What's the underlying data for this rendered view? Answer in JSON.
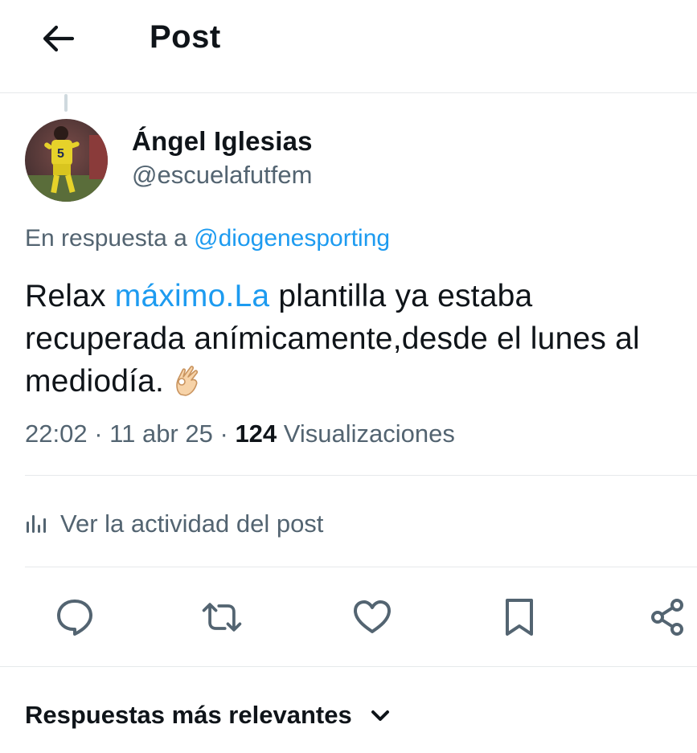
{
  "header": {
    "title": "Post"
  },
  "author": {
    "name": "Ángel Iglesias",
    "handle": "@escuelafutfem"
  },
  "reply": {
    "prefix": "En respuesta a",
    "mention": "@diogenesporting"
  },
  "tweet": {
    "text_start": "Relax",
    "link": "máximo.La",
    "text_line1_rest": "plantilla ya estaba",
    "text_line2": "recuperada anímicamente,desde el lunes al",
    "text_line3": "mediodía."
  },
  "meta": {
    "time": "22:02",
    "date": "11 abr 25",
    "views_count": "124",
    "views_label": "Visualizaciones",
    "separator": "·"
  },
  "activity": {
    "label": "Ver la actividad del post"
  },
  "sort": {
    "label": "Respuestas más relevantes"
  },
  "icons": {
    "back": "arrow-left-icon",
    "analytics": "bar-chart-icon",
    "reply": "chat-bubble-icon",
    "repost": "repost-icon",
    "like": "heart-icon",
    "bookmark": "bookmark-icon",
    "share": "share-icon",
    "chevron": "chevron-down-icon",
    "emoji": "ok-hand-emoji"
  },
  "colors": {
    "text": "#0f1419",
    "secondary": "#536471",
    "link": "#1d9bf0",
    "divider": "#e6e9eb"
  }
}
